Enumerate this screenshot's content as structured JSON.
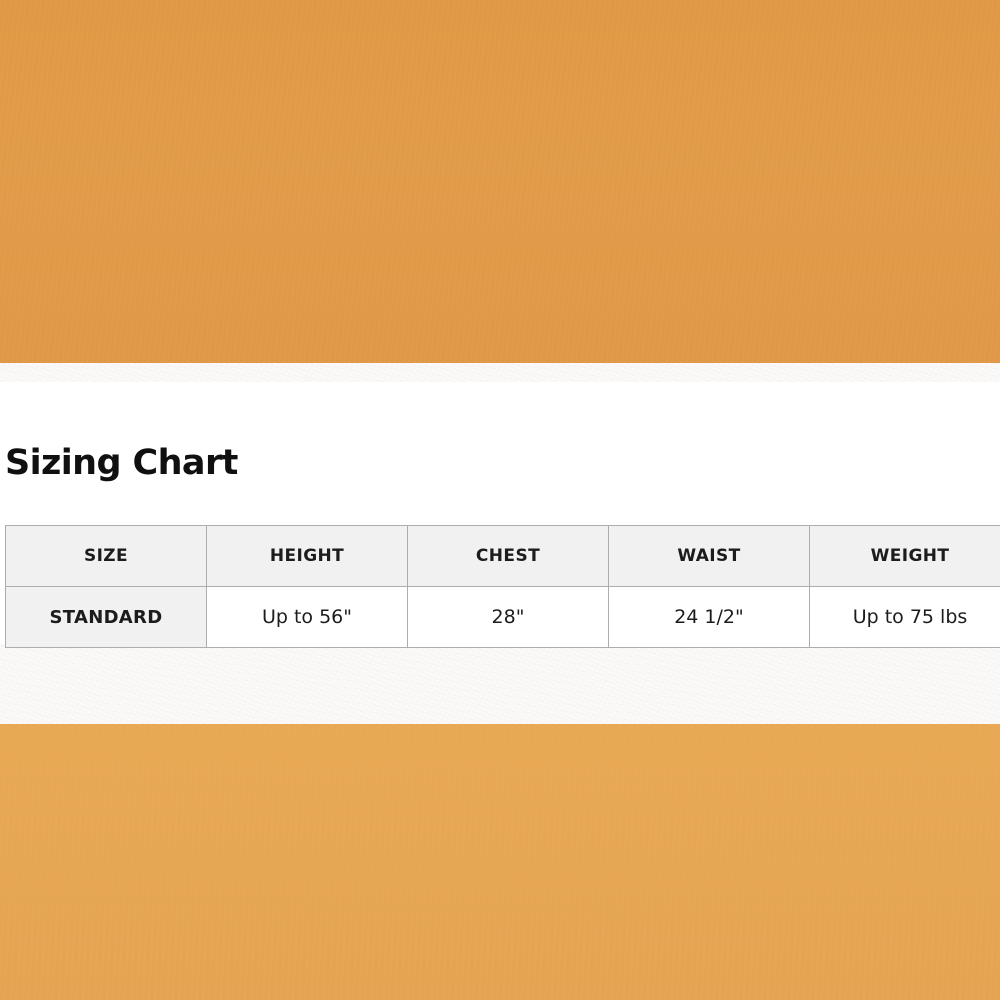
{
  "background": {
    "top_band_color": "#e09a48",
    "paper_band_color": "#fbfaf8",
    "bottom_band_color": "#e8a855"
  },
  "page": {
    "title": "Sizing Chart"
  },
  "table": {
    "headers": [
      "SIZE",
      "HEIGHT",
      "CHEST",
      "WAIST",
      "WEIGHT"
    ],
    "rows": [
      {
        "size": "STANDARD",
        "height": "Up to 56\"",
        "chest": "28\"",
        "waist": "24 1/2\"",
        "weight": "Up to 75 lbs"
      }
    ],
    "style": {
      "header_background": "#f1f1f1",
      "border_color": "#adadad",
      "cell_background": "#ffffff",
      "label_background": "#f1f1f1",
      "text_color": "#1c1c1c"
    }
  }
}
